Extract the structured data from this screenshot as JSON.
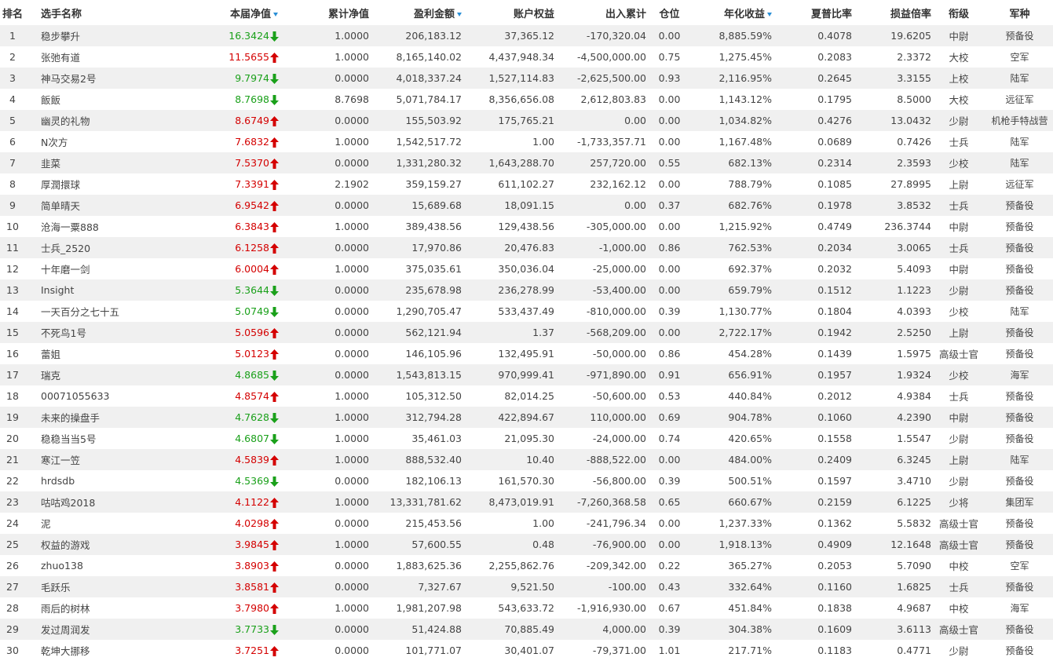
{
  "headers": {
    "rank": "排名",
    "name": "选手名称",
    "weekly_nav": "本届净值",
    "cumulative_nav": "累计净值",
    "profit": "盈利金额",
    "equity": "账户权益",
    "in_out": "出入累计",
    "position": "仓位",
    "annual_return": "年化收益",
    "sharpe": "夏普比率",
    "pl_ratio": "损益倍率",
    "rank_title": "衔级",
    "branch": "军种"
  },
  "sort_indicator_color": "#2a8fd6",
  "colors": {
    "up": "#d40000",
    "down": "#1aa01a",
    "stripe": "#f0f0f0"
  },
  "rows": [
    {
      "rank": "1",
      "name": "稳步攀升",
      "nav": "16.3424",
      "dir": "down",
      "cum": "1.0000",
      "profit": "206,183.12",
      "equity": "37,365.12",
      "inout": "-170,320.04",
      "pos": "0.00",
      "annual": "8,885.59%",
      "sharpe": "0.4078",
      "pl": "19.6205",
      "title": "中尉",
      "branch": "预备役"
    },
    {
      "rank": "2",
      "name": "张弛有道",
      "nav": "11.5655",
      "dir": "up",
      "cum": "1.0000",
      "profit": "8,165,140.02",
      "equity": "4,437,948.34",
      "inout": "-4,500,000.00",
      "pos": "0.75",
      "annual": "1,275.45%",
      "sharpe": "0.2083",
      "pl": "2.3372",
      "title": "大校",
      "branch": "空军"
    },
    {
      "rank": "3",
      "name": "神马交易2号",
      "nav": "9.7974",
      "dir": "down",
      "cum": "0.0000",
      "profit": "4,018,337.24",
      "equity": "1,527,114.83",
      "inout": "-2,625,500.00",
      "pos": "0.93",
      "annual": "2,116.95%",
      "sharpe": "0.2645",
      "pl": "3.3155",
      "title": "上校",
      "branch": "陆军"
    },
    {
      "rank": "4",
      "name": "飯飯",
      "nav": "8.7698",
      "dir": "down",
      "cum": "8.7698",
      "profit": "5,071,784.17",
      "equity": "8,356,656.08",
      "inout": "2,612,803.83",
      "pos": "0.00",
      "annual": "1,143.12%",
      "sharpe": "0.1795",
      "pl": "8.5000",
      "title": "大校",
      "branch": "远征军"
    },
    {
      "rank": "5",
      "name": "幽灵的礼物",
      "nav": "8.6749",
      "dir": "up",
      "cum": "0.0000",
      "profit": "155,503.92",
      "equity": "175,765.21",
      "inout": "0.00",
      "pos": "0.00",
      "annual": "1,034.82%",
      "sharpe": "0.4276",
      "pl": "13.0432",
      "title": "少尉",
      "branch": "机枪手特战营"
    },
    {
      "rank": "6",
      "name": "N次方",
      "nav": "7.6832",
      "dir": "up",
      "cum": "1.0000",
      "profit": "1,542,517.72",
      "equity": "1.00",
      "inout": "-1,733,357.71",
      "pos": "0.00",
      "annual": "1,167.48%",
      "sharpe": "0.0689",
      "pl": "0.7426",
      "title": "士兵",
      "branch": "陆军"
    },
    {
      "rank": "7",
      "name": "韭菜",
      "nav": "7.5370",
      "dir": "up",
      "cum": "0.0000",
      "profit": "1,331,280.32",
      "equity": "1,643,288.70",
      "inout": "257,720.00",
      "pos": "0.55",
      "annual": "682.13%",
      "sharpe": "0.2314",
      "pl": "2.3593",
      "title": "少校",
      "branch": "陆军"
    },
    {
      "rank": "8",
      "name": "厚潤擐球",
      "nav": "7.3391",
      "dir": "up",
      "cum": "2.1902",
      "profit": "359,159.27",
      "equity": "611,102.27",
      "inout": "232,162.12",
      "pos": "0.00",
      "annual": "788.79%",
      "sharpe": "0.1085",
      "pl": "27.8995",
      "title": "上尉",
      "branch": "远征军"
    },
    {
      "rank": "9",
      "name": "简单晴天",
      "nav": "6.9542",
      "dir": "up",
      "cum": "0.0000",
      "profit": "15,689.68",
      "equity": "18,091.15",
      "inout": "0.00",
      "pos": "0.37",
      "annual": "682.76%",
      "sharpe": "0.1978",
      "pl": "3.8532",
      "title": "士兵",
      "branch": "预备役"
    },
    {
      "rank": "10",
      "name": "沧海一粟888",
      "nav": "6.3843",
      "dir": "up",
      "cum": "1.0000",
      "profit": "389,438.56",
      "equity": "129,438.56",
      "inout": "-305,000.00",
      "pos": "0.00",
      "annual": "1,215.92%",
      "sharpe": "0.4749",
      "pl": "236.3744",
      "title": "中尉",
      "branch": "预备役"
    },
    {
      "rank": "11",
      "name": "士兵_2520",
      "nav": "6.1258",
      "dir": "up",
      "cum": "0.0000",
      "profit": "17,970.86",
      "equity": "20,476.83",
      "inout": "-1,000.00",
      "pos": "0.86",
      "annual": "762.53%",
      "sharpe": "0.2034",
      "pl": "3.0065",
      "title": "士兵",
      "branch": "预备役"
    },
    {
      "rank": "12",
      "name": "十年磨一剑",
      "nav": "6.0004",
      "dir": "up",
      "cum": "1.0000",
      "profit": "375,035.61",
      "equity": "350,036.04",
      "inout": "-25,000.00",
      "pos": "0.00",
      "annual": "692.37%",
      "sharpe": "0.2032",
      "pl": "5.4093",
      "title": "中尉",
      "branch": "预备役"
    },
    {
      "rank": "13",
      "name": "Insight",
      "nav": "5.3644",
      "dir": "down",
      "cum": "0.0000",
      "profit": "235,678.98",
      "equity": "236,278.99",
      "inout": "-53,400.00",
      "pos": "0.00",
      "annual": "659.79%",
      "sharpe": "0.1512",
      "pl": "1.1223",
      "title": "少尉",
      "branch": "预备役"
    },
    {
      "rank": "14",
      "name": "一天百分之七十五",
      "nav": "5.0749",
      "dir": "down",
      "cum": "0.0000",
      "profit": "1,290,705.47",
      "equity": "533,437.49",
      "inout": "-810,000.00",
      "pos": "0.39",
      "annual": "1,130.77%",
      "sharpe": "0.1804",
      "pl": "4.0393",
      "title": "少校",
      "branch": "陆军"
    },
    {
      "rank": "15",
      "name": "不死鸟1号",
      "nav": "5.0596",
      "dir": "up",
      "cum": "0.0000",
      "profit": "562,121.94",
      "equity": "1.37",
      "inout": "-568,209.00",
      "pos": "0.00",
      "annual": "2,722.17%",
      "sharpe": "0.1942",
      "pl": "2.5250",
      "title": "上尉",
      "branch": "预备役"
    },
    {
      "rank": "16",
      "name": "蕾姐",
      "nav": "5.0123",
      "dir": "up",
      "cum": "0.0000",
      "profit": "146,105.96",
      "equity": "132,495.91",
      "inout": "-50,000.00",
      "pos": "0.86",
      "annual": "454.28%",
      "sharpe": "0.1439",
      "pl": "1.5975",
      "title": "高级士官",
      "branch": "预备役"
    },
    {
      "rank": "17",
      "name": "瑞克",
      "nav": "4.8685",
      "dir": "down",
      "cum": "0.0000",
      "profit": "1,543,813.15",
      "equity": "970,999.41",
      "inout": "-971,890.00",
      "pos": "0.91",
      "annual": "656.91%",
      "sharpe": "0.1957",
      "pl": "1.9324",
      "title": "少校",
      "branch": "海军"
    },
    {
      "rank": "18",
      "name": "00071055633",
      "nav": "4.8574",
      "dir": "up",
      "cum": "1.0000",
      "profit": "105,312.50",
      "equity": "82,014.25",
      "inout": "-50,600.00",
      "pos": "0.53",
      "annual": "440.84%",
      "sharpe": "0.2012",
      "pl": "4.9384",
      "title": "士兵",
      "branch": "预备役"
    },
    {
      "rank": "19",
      "name": "未来的操盘手",
      "nav": "4.7628",
      "dir": "down",
      "cum": "1.0000",
      "profit": "312,794.28",
      "equity": "422,894.67",
      "inout": "110,000.00",
      "pos": "0.69",
      "annual": "904.78%",
      "sharpe": "0.1060",
      "pl": "4.2390",
      "title": "中尉",
      "branch": "预备役"
    },
    {
      "rank": "20",
      "name": "稳稳当当5号",
      "nav": "4.6807",
      "dir": "down",
      "cum": "1.0000",
      "profit": "35,461.03",
      "equity": "21,095.30",
      "inout": "-24,000.00",
      "pos": "0.74",
      "annual": "420.65%",
      "sharpe": "0.1558",
      "pl": "1.5547",
      "title": "少尉",
      "branch": "预备役"
    },
    {
      "rank": "21",
      "name": "寒江一笠",
      "nav": "4.5839",
      "dir": "up",
      "cum": "1.0000",
      "profit": "888,532.40",
      "equity": "10.40",
      "inout": "-888,522.00",
      "pos": "0.00",
      "annual": "484.00%",
      "sharpe": "0.2409",
      "pl": "6.3245",
      "title": "上尉",
      "branch": "陆军"
    },
    {
      "rank": "22",
      "name": "hrdsdb",
      "nav": "4.5369",
      "dir": "down",
      "cum": "0.0000",
      "profit": "182,106.13",
      "equity": "161,570.30",
      "inout": "-56,800.00",
      "pos": "0.39",
      "annual": "500.51%",
      "sharpe": "0.1597",
      "pl": "3.4710",
      "title": "少尉",
      "branch": "预备役"
    },
    {
      "rank": "23",
      "name": "咕咕鸡2018",
      "nav": "4.1122",
      "dir": "up",
      "cum": "1.0000",
      "profit": "13,331,781.62",
      "equity": "8,473,019.91",
      "inout": "-7,260,368.58",
      "pos": "0.65",
      "annual": "660.67%",
      "sharpe": "0.2159",
      "pl": "6.1225",
      "title": "少将",
      "branch": "集团军"
    },
    {
      "rank": "24",
      "name": "泥",
      "nav": "4.0298",
      "dir": "up",
      "cum": "0.0000",
      "profit": "215,453.56",
      "equity": "1.00",
      "inout": "-241,796.34",
      "pos": "0.00",
      "annual": "1,237.33%",
      "sharpe": "0.1362",
      "pl": "5.5832",
      "title": "高级士官",
      "branch": "预备役"
    },
    {
      "rank": "25",
      "name": "权益的游戏",
      "nav": "3.9845",
      "dir": "up",
      "cum": "1.0000",
      "profit": "57,600.55",
      "equity": "0.48",
      "inout": "-76,900.00",
      "pos": "0.00",
      "annual": "1,918.13%",
      "sharpe": "0.4909",
      "pl": "12.1648",
      "title": "高级士官",
      "branch": "预备役"
    },
    {
      "rank": "26",
      "name": "zhuo138",
      "nav": "3.8903",
      "dir": "up",
      "cum": "0.0000",
      "profit": "1,883,625.36",
      "equity": "2,255,862.76",
      "inout": "-209,342.00",
      "pos": "0.22",
      "annual": "365.27%",
      "sharpe": "0.2053",
      "pl": "5.7090",
      "title": "中校",
      "branch": "空军"
    },
    {
      "rank": "27",
      "name": "毛跃乐",
      "nav": "3.8581",
      "dir": "up",
      "cum": "0.0000",
      "profit": "7,327.67",
      "equity": "9,521.50",
      "inout": "-100.00",
      "pos": "0.43",
      "annual": "332.64%",
      "sharpe": "0.1160",
      "pl": "1.6825",
      "title": "士兵",
      "branch": "预备役"
    },
    {
      "rank": "28",
      "name": "雨后的树林",
      "nav": "3.7980",
      "dir": "up",
      "cum": "1.0000",
      "profit": "1,981,207.98",
      "equity": "543,633.72",
      "inout": "-1,916,930.00",
      "pos": "0.67",
      "annual": "451.84%",
      "sharpe": "0.1838",
      "pl": "4.9687",
      "title": "中校",
      "branch": "海军"
    },
    {
      "rank": "29",
      "name": "发过周润发",
      "nav": "3.7733",
      "dir": "down",
      "cum": "0.0000",
      "profit": "51,424.88",
      "equity": "70,885.49",
      "inout": "4,000.00",
      "pos": "0.39",
      "annual": "304.38%",
      "sharpe": "0.1609",
      "pl": "3.6113",
      "title": "高级士官",
      "branch": "预备役"
    },
    {
      "rank": "30",
      "name": "乾坤大挪移",
      "nav": "3.7251",
      "dir": "up",
      "cum": "0.0000",
      "profit": "101,771.07",
      "equity": "30,401.07",
      "inout": "-79,371.00",
      "pos": "1.01",
      "annual": "217.71%",
      "sharpe": "0.1183",
      "pl": "0.4771",
      "title": "少尉",
      "branch": "预备役"
    }
  ]
}
